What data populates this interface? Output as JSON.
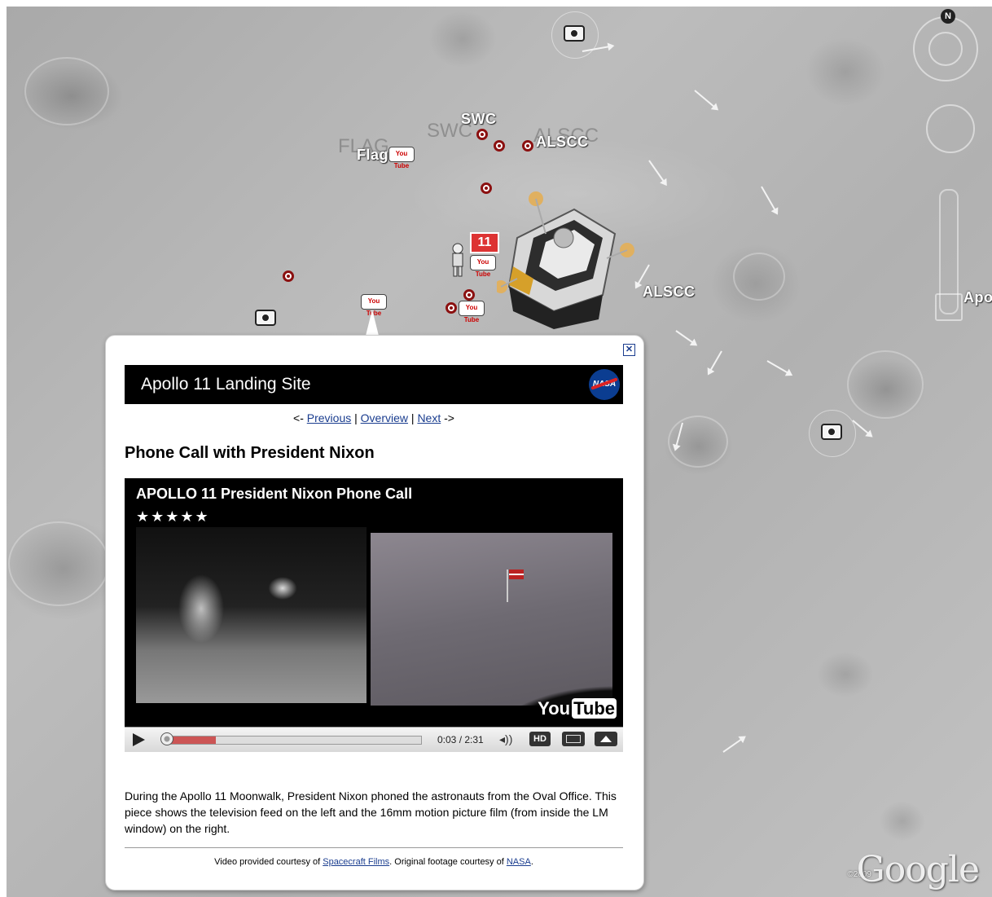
{
  "map": {
    "labels": {
      "flag": "Flag",
      "flag_ghost": "FLAG",
      "swc": "SWC",
      "swc_ghost": "SWC",
      "alscc_top": "ALSCC",
      "alscc_ghost": "ALSCC",
      "alscc_right": "ALSCC",
      "apollo_edge": "Apo"
    },
    "lm_number": "11",
    "compass_n": "N",
    "youtube_marker": "You Tube",
    "copyright": "©2009",
    "google_logo": "Google"
  },
  "balloon": {
    "close_label": "✕",
    "header_title": "Apollo 11 Landing Site",
    "nasa_logo": "NASA",
    "nav": {
      "prev_arrow": "<- ",
      "previous": "Previous",
      "sep1": " | ",
      "overview": "Overview",
      "sep2": " | ",
      "next": "Next",
      "next_arrow": " ->"
    },
    "section_title": "Phone Call with President Nixon",
    "video": {
      "title": "APOLLO 11 President Nixon Phone Call",
      "rating_stars": "★★★★★",
      "rating": 5,
      "progress_fraction": 0.2,
      "time": "0:03 / 2:31",
      "hd_label": "HD",
      "youtube_logo_you": "You",
      "youtube_logo_tube": "Tube"
    },
    "description": "During the Apollo 11 Moonwalk, President Nixon phoned the astronauts from the Oval Office. This piece shows the television feed on the left and the 16mm motion picture film (from inside the LM window) on the right.",
    "credit": {
      "prefix": "Video provided courtesy of ",
      "link1": "Spacecraft Films",
      "middle": ". Original footage courtesy of ",
      "link2": "NASA",
      "suffix": "."
    }
  },
  "colors": {
    "link": "#1a3d8f",
    "header_bg": "#000000",
    "marker_red": "#8b1010",
    "progress_fill": "#cc5555"
  }
}
